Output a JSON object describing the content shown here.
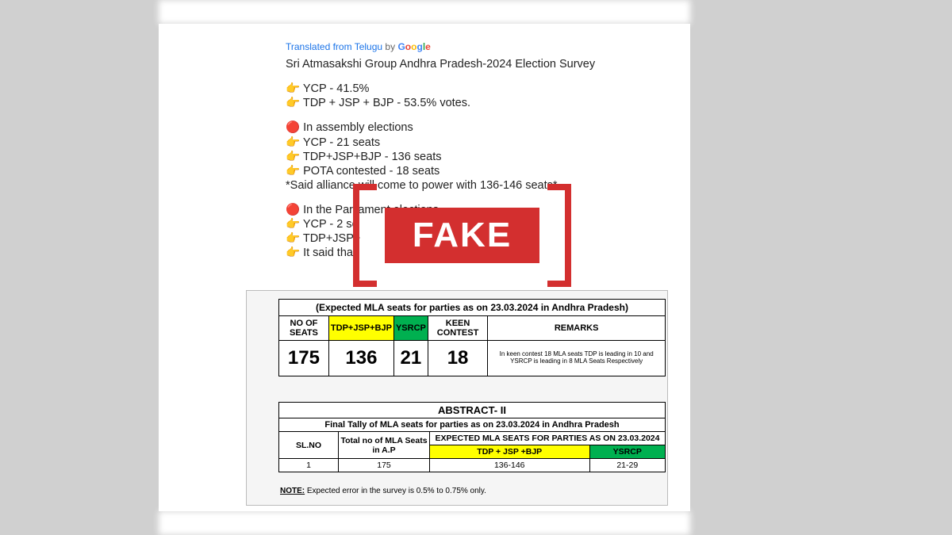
{
  "translate": {
    "prefix": "Translated from Telugu",
    "by": "by"
  },
  "post": {
    "title": "Sri Atmasakshi Group Andhra Pradesh-2024 Election Survey",
    "line_votes_1": "YCP - 41.5%",
    "line_votes_2": "TDP + JSP + BJP - 53.5% votes.",
    "assembly_header": "In assembly elections",
    "assembly_1": "YCP - 21 seats",
    "assembly_2": "TDP+JSP+BJP - 136 seats",
    "assembly_3": "POTA contested - 18 seats",
    "assembly_note": "*Said alliance will come to power with 136-146 seats*",
    "parl_header": "In the Parliament elections",
    "parl_1": "YCP - 2 se",
    "parl_2": "TDP+JSP+",
    "parl_3": "It said tha"
  },
  "fake_label": "FAKE",
  "table1": {
    "caption": "(Expected MLA seats for parties as on 23.03.2024 in Andhra Pradesh)",
    "headers": {
      "col1": "NO OF SEATS",
      "col2": "TDP+JSP+BJP",
      "col3": "YSRCP",
      "col4": "KEEN CONTEST",
      "col5": "REMARKS"
    },
    "values": {
      "v1": "175",
      "v2": "136",
      "v3": "21",
      "v4": "18",
      "remarks": "In keen contest 18 MLA seats TDP is leading in 10 and YSRCP is leading in 8 MLA Seats Respectively"
    }
  },
  "table2": {
    "title": "ABSTRACT- II",
    "subtitle": "Final Tally of MLA seats for parties as on 23.03.2024 in Andhra Pradesh",
    "headers": {
      "slno": "SL.NO",
      "total": "Total no of MLA Seats in A.P",
      "expected": "EXPECTED MLA SEATS FOR PARTIES AS ON 23.03.2024",
      "tdp": "TDP + JSP +BJP",
      "ysrcp": "YSRCP"
    },
    "row": {
      "slno": "1",
      "total": "175",
      "tdp": "136-146",
      "ysrcp": "21-29"
    }
  },
  "note": {
    "label": "NOTE:",
    "text": " Expected error in the survey is 0.5% to 0.75% only."
  },
  "chart_data": {
    "type": "table",
    "title": "Expected MLA seats for parties as on 23.03.2024 in Andhra Pradesh",
    "abstract1": {
      "no_of_seats": 175,
      "tdp_jsp_bjp": 136,
      "ysrcp": 21,
      "keen_contest": 18,
      "remarks": "In keen contest 18 MLA seats TDP is leading in 10 and YSRCP is leading in 8 MLA Seats Respectively"
    },
    "abstract2": {
      "sl_no": 1,
      "total_mla_seats": 175,
      "expected_tdp_jsp_bjp": "136-146",
      "expected_ysrcp": "21-29"
    },
    "vote_share": {
      "YCP": 41.5,
      "TDP+JSP+BJP": 53.5
    },
    "assembly_seats": {
      "YCP": 21,
      "TDP+JSP+BJP": 136,
      "POTA_contested": 18,
      "alliance_range": "136-146"
    },
    "note": "Expected error in the survey is 0.5% to 0.75% only."
  }
}
